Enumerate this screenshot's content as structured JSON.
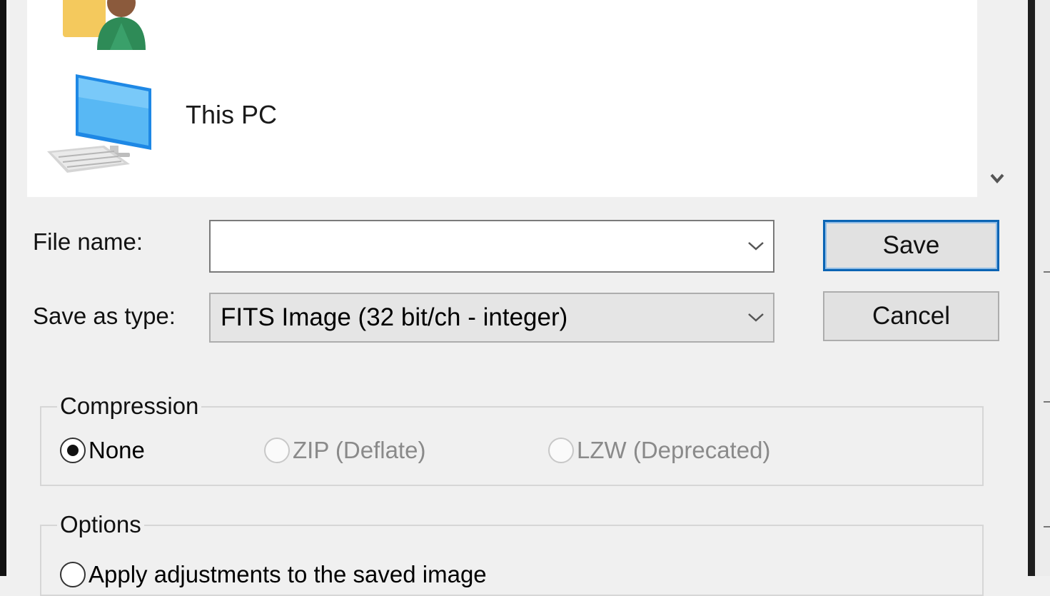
{
  "nav": {
    "items": [
      {
        "label": ""
      },
      {
        "label": "This PC"
      }
    ]
  },
  "form": {
    "file_name_label": "File name:",
    "file_name_value": "",
    "save_as_type_label": "Save as type:",
    "save_as_type_value": "FITS Image (32 bit/ch - integer)"
  },
  "buttons": {
    "save": "Save",
    "cancel": "Cancel"
  },
  "compression": {
    "title": "Compression",
    "options": [
      {
        "label": "None",
        "checked": true,
        "enabled": true
      },
      {
        "label": "ZIP (Deflate)",
        "checked": false,
        "enabled": false
      },
      {
        "label": "LZW (Deprecated)",
        "checked": false,
        "enabled": false
      }
    ]
  },
  "options_group": {
    "title": "Options",
    "options": [
      {
        "label": "Apply adjustments to the saved image",
        "checked": false
      }
    ]
  }
}
